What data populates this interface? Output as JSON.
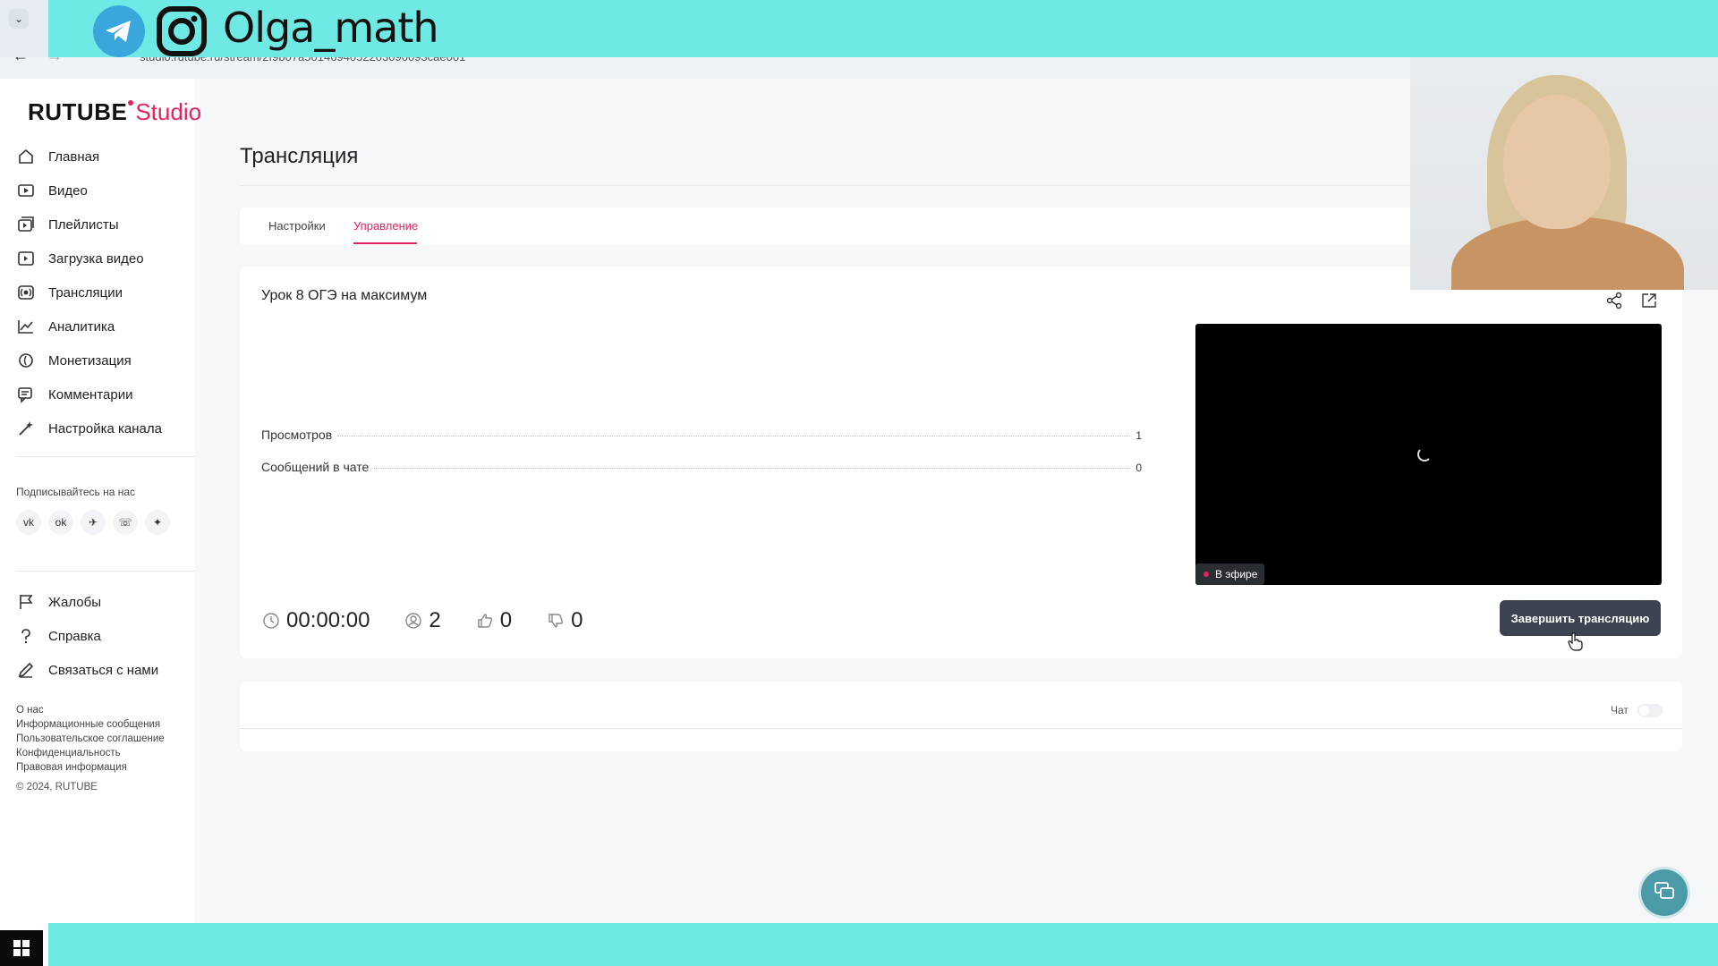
{
  "overlay": {
    "handle": "Olga_math"
  },
  "browser": {
    "url": "studio.rutube.ru/stream/2f9b07a5014694052203090093cae001"
  },
  "brand": {
    "name": "RUTUBE",
    "product": "Studio",
    "accent": "#e0245e"
  },
  "sidebar": {
    "items": [
      {
        "label": "Главная",
        "icon": "home-icon"
      },
      {
        "label": "Видео",
        "icon": "video-icon"
      },
      {
        "label": "Плейлисты",
        "icon": "playlist-icon"
      },
      {
        "label": "Загрузка видео",
        "icon": "upload-icon"
      },
      {
        "label": "Трансляции",
        "icon": "broadcast-icon"
      },
      {
        "label": "Аналитика",
        "icon": "analytics-icon"
      },
      {
        "label": "Монетизация",
        "icon": "monetization-icon"
      },
      {
        "label": "Комментарии",
        "icon": "comments-icon"
      },
      {
        "label": "Настройка канала",
        "icon": "channel-settings-icon"
      }
    ],
    "follow_title": "Подписывайтесь на нас",
    "socials": [
      "vk-icon",
      "ok-icon",
      "telegram-icon",
      "viber-icon",
      "plus-icon"
    ],
    "secondary": [
      {
        "label": "Жалобы",
        "icon": "flag-icon"
      },
      {
        "label": "Справка",
        "icon": "help-icon"
      },
      {
        "label": "Связаться с нами",
        "icon": "pen-icon"
      }
    ],
    "footer_links": [
      "О нас",
      "Информационные сообщения",
      "Пользовательское соглашение",
      "Конфиденциальность",
      "Правовая информация"
    ],
    "copyright": "© 2024, RUTUBE"
  },
  "page": {
    "title": "Трансляция",
    "tabs": [
      {
        "label": "Настройки",
        "active": false
      },
      {
        "label": "Управление",
        "active": true
      }
    ]
  },
  "stream": {
    "title": "Урок 8 ОГЭ на максимум",
    "stats": [
      {
        "label": "Просмотров",
        "value": "1"
      },
      {
        "label": "Сообщений в чате",
        "value": "0"
      }
    ],
    "duration": "00:00:00",
    "viewers": "2",
    "likes": "0",
    "dislikes": "0",
    "live_label": "В эфире",
    "end_button": "Завершить трансляцию"
  },
  "chat": {
    "label": "Чат",
    "enabled": false
  }
}
